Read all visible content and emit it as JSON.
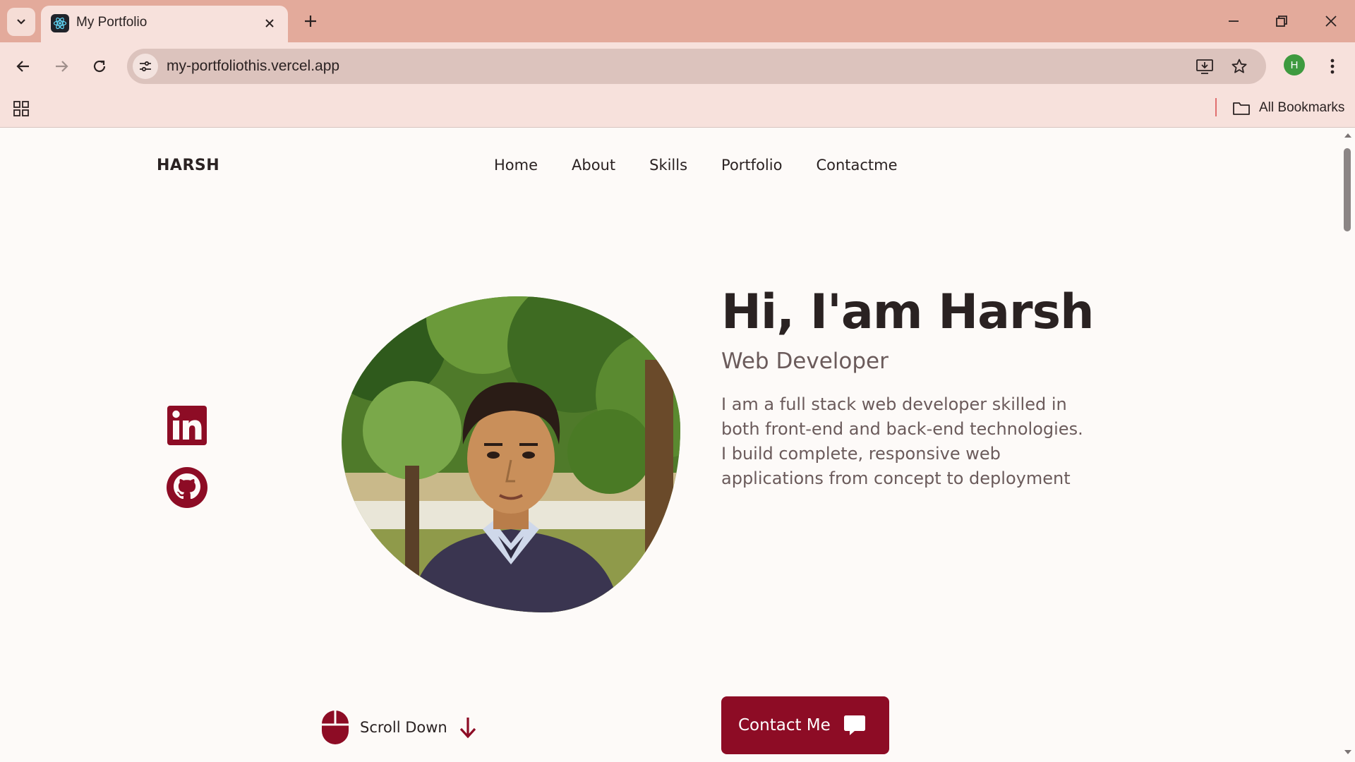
{
  "browser": {
    "tab_title": "My Portfolio",
    "url": "my-portfoliothis.vercel.app",
    "profile_initial": "H",
    "bookmarks_label": "All Bookmarks",
    "accent_color": "#e3aa9b",
    "icons": [
      "tab-search-icon",
      "react-favicon-icon",
      "close-icon",
      "plus-icon",
      "minimize-icon",
      "restore-icon",
      "window-close-icon",
      "back-arrow-icon",
      "forward-arrow-icon",
      "reload-icon",
      "site-settings-icon",
      "install-app-icon",
      "star-icon",
      "kebab-menu-icon",
      "apps-grid-icon",
      "folder-icon"
    ]
  },
  "page": {
    "brand": "HARSH",
    "nav": [
      "Home",
      "About",
      "Skills",
      "Portfolio",
      "Contactme"
    ],
    "hero": {
      "title": "Hi, I'am Harsh",
      "subtitle": "Web Developer",
      "description": "I am a full stack web developer skilled in both front-end and back-end technologies. I build complete, responsive web applications from concept to deployment",
      "button_label": "Contact Me"
    },
    "scroll_label": "Scroll Down",
    "socials": [
      "linkedin-icon",
      "github-icon"
    ],
    "brand_color": "#8d0c25"
  }
}
